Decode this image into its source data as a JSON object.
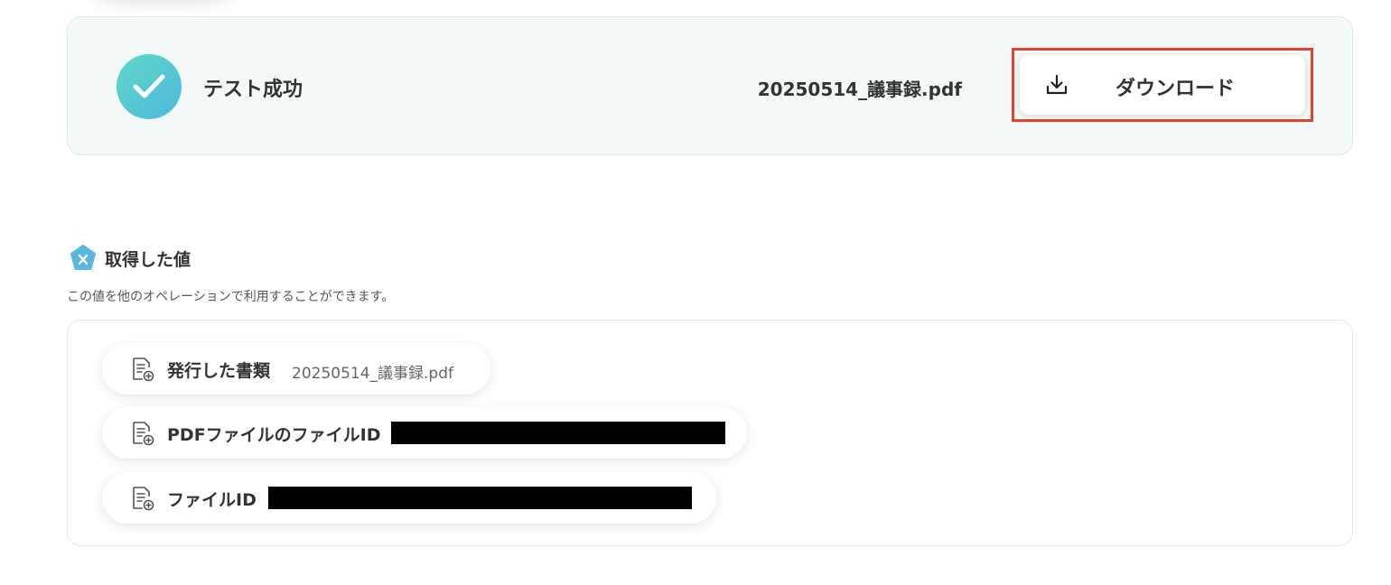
{
  "test_result": {
    "status_text": "テスト成功",
    "file_name": "20250514_議事録.pdf",
    "download_label": "ダウンロード",
    "success_color_start": "#5fd8c6",
    "success_color_end": "#4fb8de",
    "highlight_color": "#e4432d"
  },
  "acquired_values": {
    "title": "取得した値",
    "description": "この値を他のオペレーションで利用することができます。",
    "items": [
      {
        "label": "発行した書類",
        "value": "20250514_議事録.pdf",
        "icon": "document-icon"
      },
      {
        "label": "PDFファイルのファイルID",
        "value": "",
        "redacted": true,
        "icon": "document-icon"
      },
      {
        "label": "ファイルID",
        "value": "",
        "redacted": true,
        "icon": "document-icon"
      }
    ]
  }
}
